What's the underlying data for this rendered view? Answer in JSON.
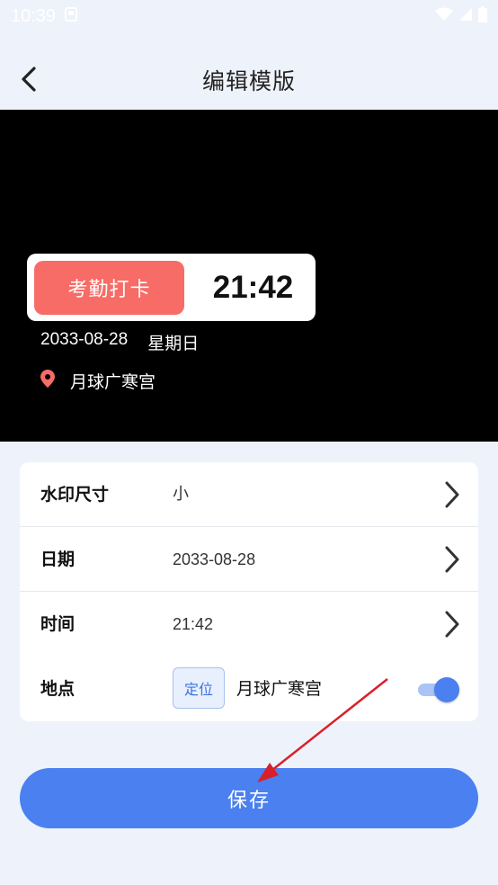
{
  "status_bar": {
    "time": "10:39"
  },
  "header": {
    "title": "编辑模版"
  },
  "watermark": {
    "badge_label": "考勤打卡",
    "time": "21:42",
    "date": "2033-08-28",
    "weekday": "星期日",
    "location": "月球广寒宫"
  },
  "settings": {
    "rows": [
      {
        "label": "水印尺寸",
        "value": "小"
      },
      {
        "label": "日期",
        "value": "2033-08-28"
      },
      {
        "label": "时间",
        "value": "21:42"
      },
      {
        "label": "地点",
        "locate_button": "定位",
        "value": "月球广寒宫",
        "toggle_on": true
      }
    ]
  },
  "save_label": "保存",
  "colors": {
    "accent": "#4a80f0",
    "badge": "#f76c66",
    "annotation_arrow": "#d8202a"
  }
}
